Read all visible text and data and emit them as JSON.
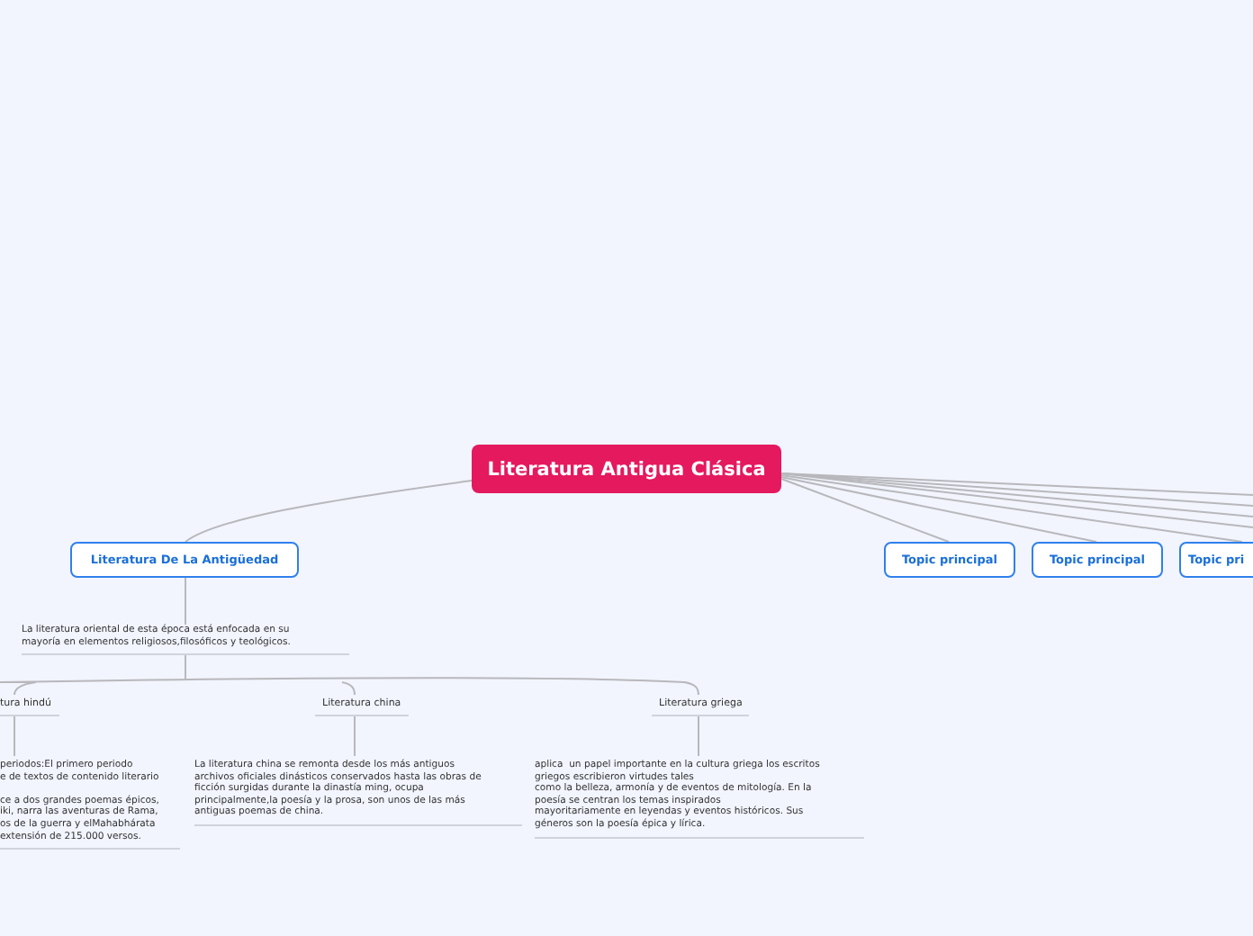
{
  "central_topic": {
    "label": "Literatura Antigua Clásica"
  },
  "main_topics": [
    {
      "label": "Literatura De La Antigüedad"
    },
    {
      "label": "Topic principal"
    },
    {
      "label": "Topic principal"
    },
    {
      "label": "Topic pri"
    }
  ],
  "notes": [
    {
      "text": "La literatura oriental de esta época está enfocada en su\nmayoría en elementos religiosos,filosóficos y teológicos."
    }
  ],
  "subtopics": [
    {
      "label": "tura hindú",
      "text": "periodos:El primero periodo\ne de textos de contenido literario\n\nce a dos grandes poemas épicos,\niki, narra las aventuras de Rama,\nos de la guerra y elMahabhárata\nextensión de 215.000 versos."
    },
    {
      "label": "Literatura china",
      "text": "La literatura china se remonta desde los más antiguos\narchivos oficiales dinásticos conservados hasta las obras de\nficción surgidas durante la dinastía ming, ocupa\nprincipalmente,la poesía y la prosa, son unos de las más\nantiguas poemas de china."
    },
    {
      "label": "Literatura griega",
      "text": "aplica  un papel importante en la cultura griega los escritos\ngriegos escribieron virtudes tales\ncomo la belleza, armonía y de eventos de mitología. En la\npoesía se centran los temas inspirados\nmayoritariamente en leyendas y eventos históricos. Sus\ngéneros son la poesía épica y lírica."
    }
  ]
}
